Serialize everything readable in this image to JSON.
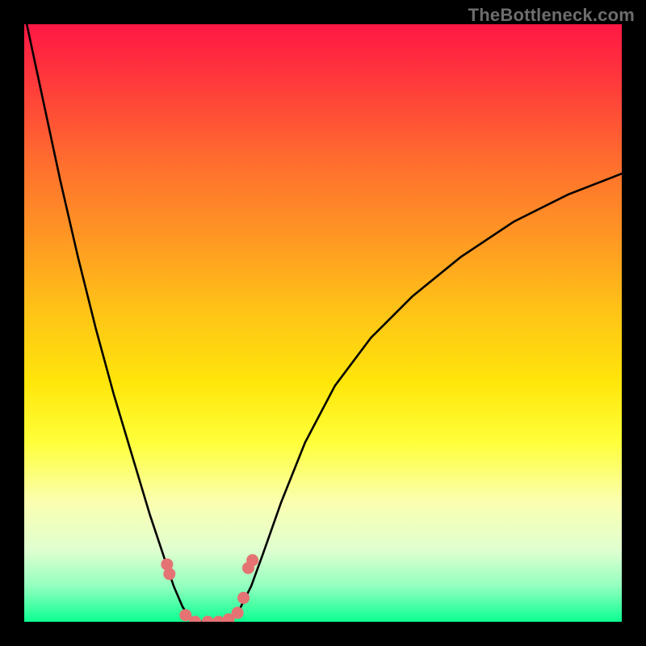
{
  "watermark": {
    "text": "TheBottleneck.com"
  },
  "colors": {
    "black": "#000000",
    "curve": "#000000",
    "marker": "#e57373"
  },
  "gradient_stops": [
    {
      "offset": 0.0,
      "color": "#ff1744"
    },
    {
      "offset": 0.1,
      "color": "#ff3b3b"
    },
    {
      "offset": 0.22,
      "color": "#ff6a2f"
    },
    {
      "offset": 0.35,
      "color": "#ff9524"
    },
    {
      "offset": 0.48,
      "color": "#ffc317"
    },
    {
      "offset": 0.6,
      "color": "#ffe60a"
    },
    {
      "offset": 0.7,
      "color": "#ffff3a"
    },
    {
      "offset": 0.8,
      "color": "#faffb0"
    },
    {
      "offset": 0.88,
      "color": "#e0ffd0"
    },
    {
      "offset": 0.94,
      "color": "#93ffbf"
    },
    {
      "offset": 1.0,
      "color": "#0bff91"
    }
  ],
  "chart_data": {
    "type": "line",
    "title": "",
    "xlabel": "",
    "ylabel": "",
    "xlim": [
      0,
      1
    ],
    "ylim": [
      0,
      1
    ],
    "series": [
      {
        "name": "bottleneck-curve",
        "x": [
          0.0,
          0.03,
          0.06,
          0.09,
          0.12,
          0.15,
          0.18,
          0.21,
          0.23,
          0.25,
          0.265,
          0.278,
          0.29,
          0.3,
          0.32,
          0.34,
          0.36,
          0.38,
          0.4,
          0.43,
          0.47,
          0.52,
          0.58,
          0.65,
          0.73,
          0.82,
          0.91,
          1.0
        ],
        "y": [
          1.02,
          0.88,
          0.74,
          0.61,
          0.49,
          0.38,
          0.28,
          0.18,
          0.12,
          0.06,
          0.025,
          0.005,
          0.0,
          0.0,
          0.0,
          0.003,
          0.02,
          0.06,
          0.115,
          0.2,
          0.3,
          0.395,
          0.475,
          0.545,
          0.61,
          0.67,
          0.715,
          0.75
        ]
      }
    ],
    "markers": {
      "name": "highlighted-points",
      "color": "#e57373",
      "radius_px": 7.5,
      "points": [
        {
          "x": 0.239,
          "y": 0.096
        },
        {
          "x": 0.243,
          "y": 0.08
        },
        {
          "x": 0.27,
          "y": 0.011
        },
        {
          "x": 0.286,
          "y": 0.0
        },
        {
          "x": 0.307,
          "y": 0.0
        },
        {
          "x": 0.325,
          "y": 0.0
        },
        {
          "x": 0.342,
          "y": 0.004
        },
        {
          "x": 0.357,
          "y": 0.015
        },
        {
          "x": 0.367,
          "y": 0.04
        },
        {
          "x": 0.375,
          "y": 0.09
        },
        {
          "x": 0.382,
          "y": 0.103
        }
      ]
    }
  }
}
